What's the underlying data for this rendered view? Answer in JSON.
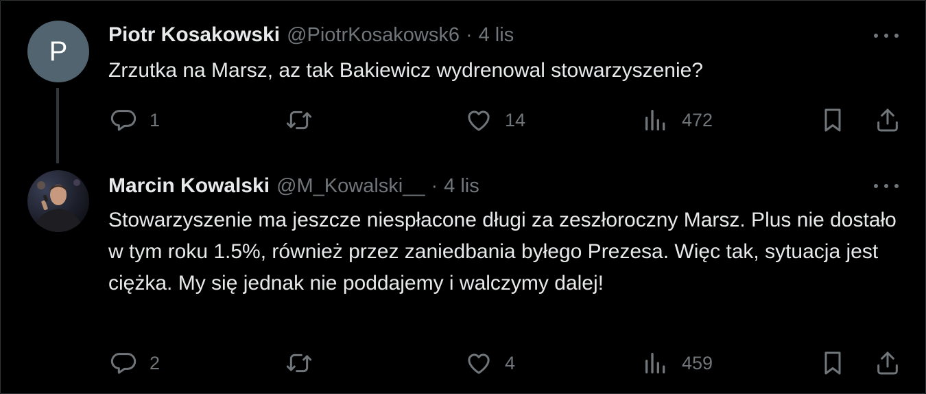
{
  "tweets": [
    {
      "avatar_letter": "P",
      "name": "Piotr Kosakowski",
      "handle": "@PiotrKosakowsk6",
      "separator": "·",
      "time": "4 lis",
      "text": "Zrzutka na Marsz, az tak Bakiewicz wydrenowal stowarzyszenie?",
      "replies": "1",
      "reposts": "",
      "likes": "14",
      "views": "472"
    },
    {
      "name": "Marcin Kowalski",
      "handle": "@M_Kowalski__",
      "separator": "·",
      "time": "4 lis",
      "text": "Stowarzyszenie ma jeszcze niespłacone długi za zeszłoroczny Marsz. Plus nie dostało w tym roku 1.5%, również przez zaniedbania byłego Prezesa. Więc tak, sytuacja jest ciężka. My się jednak nie poddajemy i walczymy dalej!",
      "replies": "2",
      "reposts": "",
      "likes": "4",
      "views": "459"
    }
  ],
  "icons": {
    "more": "more-horizontal-icon",
    "reply": "reply-icon",
    "repost": "repost-icon",
    "like": "heart-icon",
    "views": "views-chart-icon",
    "bookmark": "bookmark-icon",
    "share": "share-icon"
  },
  "colors": {
    "background": "#000000",
    "text": "#e7e9ea",
    "secondary": "#71767b",
    "avatar_bg": "#536471"
  }
}
